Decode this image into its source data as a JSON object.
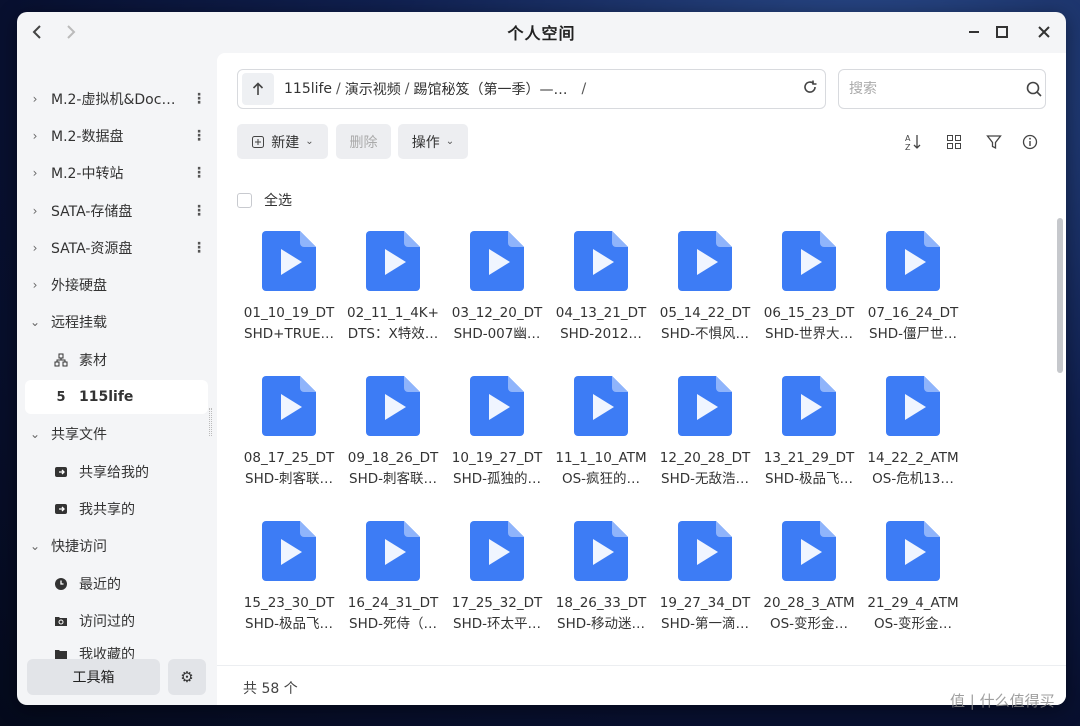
{
  "window": {
    "title": "个人空间"
  },
  "sidebar": {
    "items": [
      {
        "label": "M.2-虚拟机&Doc…",
        "type": "volume"
      },
      {
        "label": "M.2-数据盘",
        "type": "volume"
      },
      {
        "label": "M.2-中转站",
        "type": "volume"
      },
      {
        "label": "SATA-存储盘",
        "type": "volume"
      },
      {
        "label": "SATA-资源盘",
        "type": "volume"
      },
      {
        "label": "外接硬盘",
        "type": "group"
      },
      {
        "label": "远程挂载",
        "type": "group-open"
      },
      {
        "label": "素材",
        "icon": "network-icon"
      },
      {
        "label": "115life",
        "icon": "cloud-115-icon",
        "active": true
      },
      {
        "label": "共享文件",
        "type": "group-open"
      },
      {
        "label": "共享给我的",
        "icon": "share-in-icon"
      },
      {
        "label": "我共享的",
        "icon": "share-out-icon"
      },
      {
        "label": "快捷访问",
        "type": "group-open"
      },
      {
        "label": "最近的",
        "icon": "clock-icon"
      },
      {
        "label": "访问过的",
        "icon": "folder-history-icon"
      },
      {
        "label": "我收藏的",
        "icon": "folder-star-icon"
      }
    ],
    "toolbox_label": "工具箱"
  },
  "pathbar": {
    "crumbs": [
      "115life",
      "演示视频",
      "踢馆秘笈（第一季）—…"
    ],
    "end_sep": "/"
  },
  "search": {
    "placeholder": "搜索"
  },
  "toolbar": {
    "new_label": "新建",
    "delete_label": "删除",
    "operate_label": "操作"
  },
  "select_all_label": "全选",
  "files": [
    {
      "line1": "01_10_19_DT",
      "line2": "SHD+TRUE…"
    },
    {
      "line1": "02_11_1_4K+",
      "line2": "DTS：X特效…"
    },
    {
      "line1": "03_12_20_DT",
      "line2": "SHD-007幽…"
    },
    {
      "line1": "04_13_21_DT",
      "line2": "SHD-2012…"
    },
    {
      "line1": "05_14_22_DT",
      "line2": "SHD-不惧风…"
    },
    {
      "line1": "06_15_23_DT",
      "line2": "SHD-世界大…"
    },
    {
      "line1": "07_16_24_DT",
      "line2": "SHD-僵尸世…"
    },
    {
      "line1": "08_17_25_DT",
      "line2": "SHD-刺客联…"
    },
    {
      "line1": "09_18_26_DT",
      "line2": "SHD-刺客联…"
    },
    {
      "line1": "10_19_27_DT",
      "line2": "SHD-孤独的…"
    },
    {
      "line1": "11_1_10_ATM",
      "line2": "OS-疯狂的…"
    },
    {
      "line1": "12_20_28_DT",
      "line2": "SHD-无敌浩…"
    },
    {
      "line1": "13_21_29_DT",
      "line2": "SHD-极品飞…"
    },
    {
      "line1": "14_22_2_ATM",
      "line2": "OS-危机13…"
    },
    {
      "line1": "15_23_30_DT",
      "line2": "SHD-极品飞…"
    },
    {
      "line1": "16_24_31_DT",
      "line2": "SHD-死侍（…"
    },
    {
      "line1": "17_25_32_DT",
      "line2": "SHD-环太平…"
    },
    {
      "line1": "18_26_33_DT",
      "line2": "SHD-移动迷…"
    },
    {
      "line1": "19_27_34_DT",
      "line2": "SHD-第一滴…"
    },
    {
      "line1": "20_28_3_ATM",
      "line2": "OS-变形金…"
    },
    {
      "line1": "21_29_4_ATM",
      "line2": "OS-变形金…"
    }
  ],
  "status": {
    "count_text": "共 58 个"
  },
  "watermark": "值 | 什么值得买",
  "colors": {
    "accent": "#2f6ef0",
    "file_icon": "#3d7cf5"
  }
}
